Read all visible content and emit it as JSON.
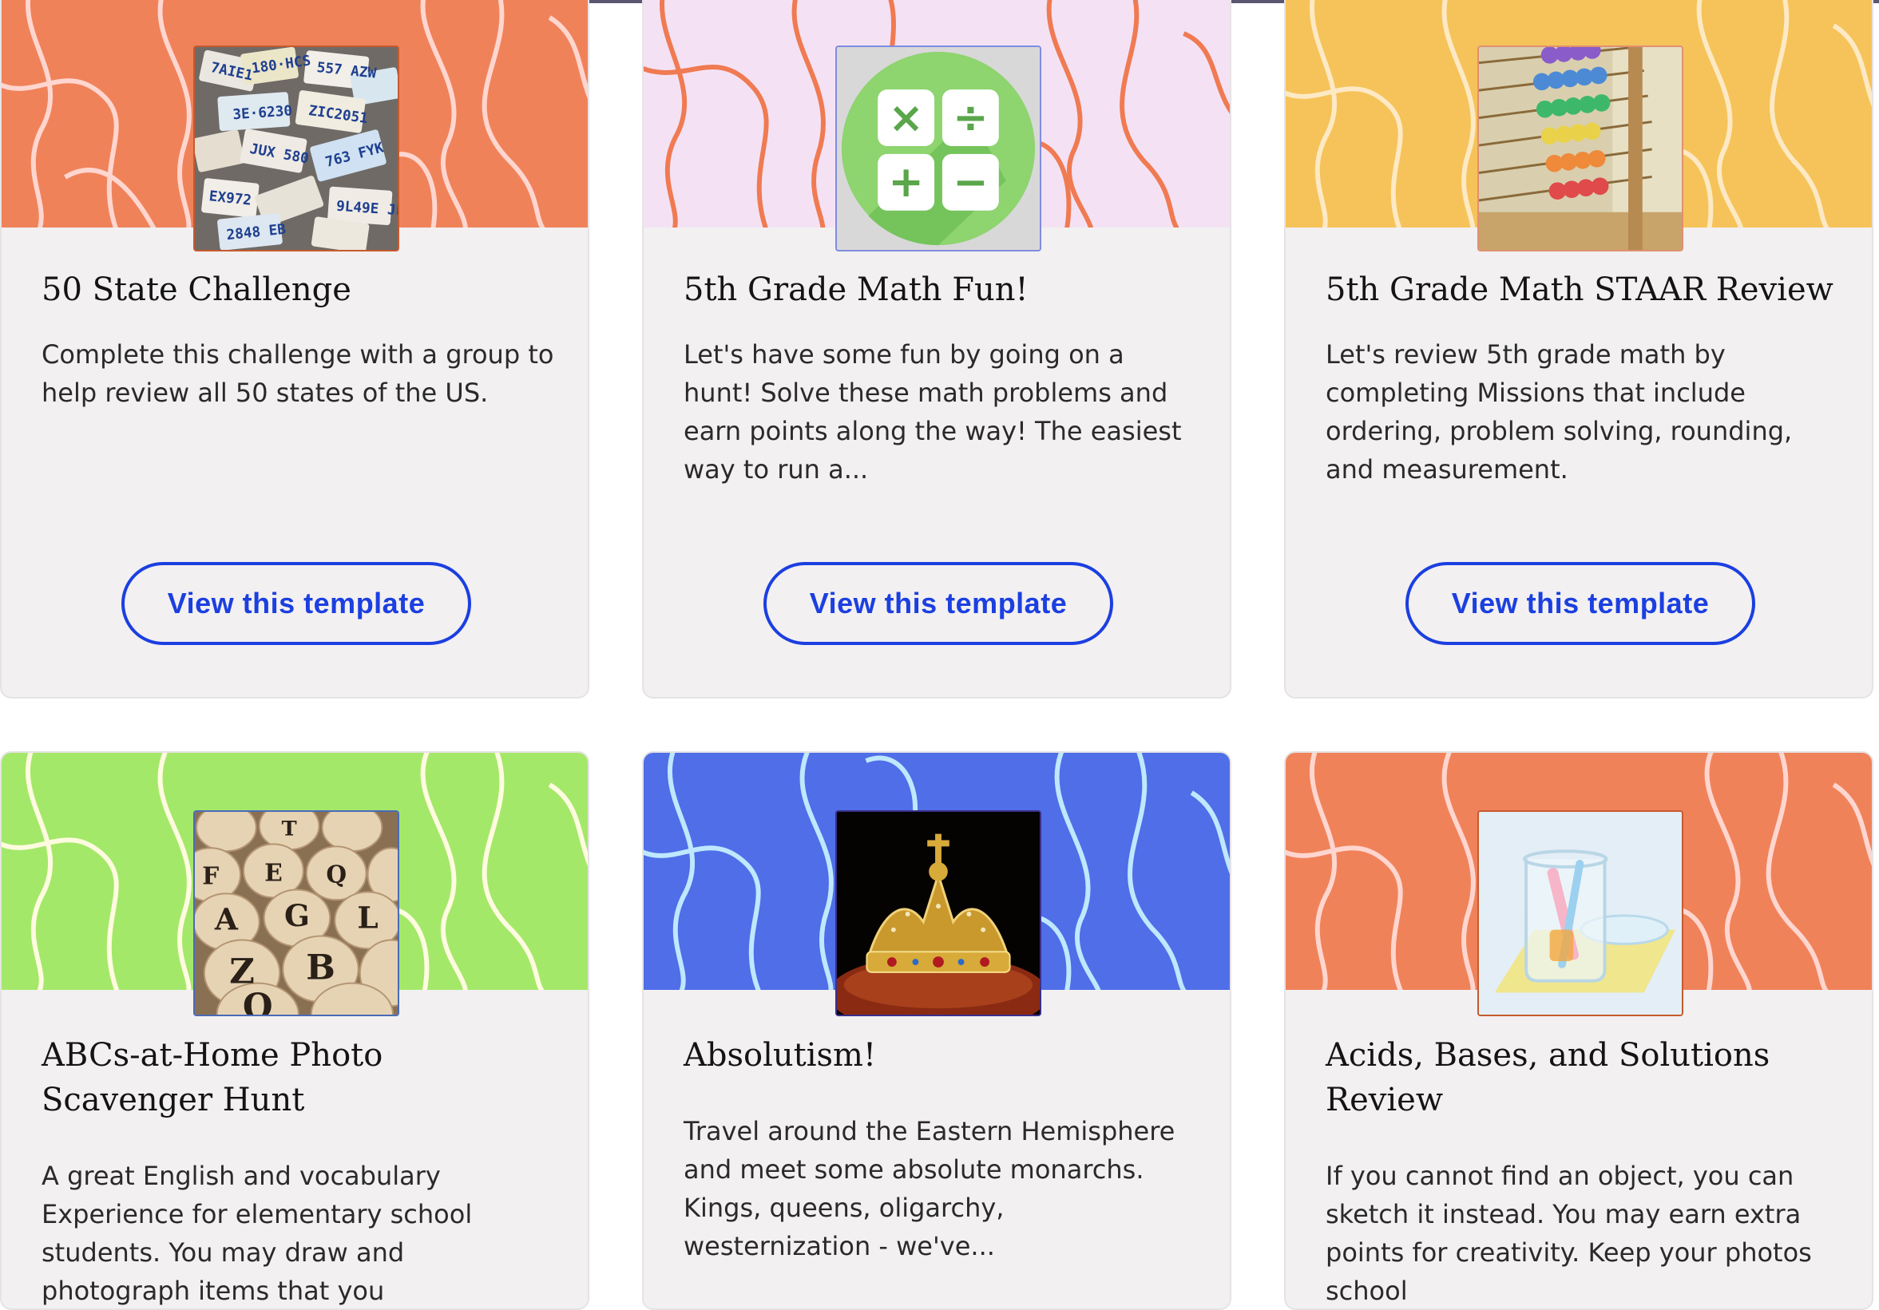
{
  "templates": [
    {
      "title": "50 State Challenge",
      "description": "Complete this challenge with a group to help review all 50 states of the US.",
      "button_label": "View this template",
      "banner_color": "#f0825a",
      "line_color": "#ffd6cf",
      "thumb_icon": "license-plates-photo"
    },
    {
      "title": "5th Grade Math Fun!",
      "description": "Let's have some fun by going on a hunt! Solve these math problems and earn points along the way! The easiest way to run a...",
      "button_label": "View this template",
      "banner_color": "#f4e2f4",
      "line_color": "#f07a52",
      "thumb_icon": "calculator-icon",
      "thumb_symbols": [
        "×",
        "÷",
        "+",
        "−"
      ]
    },
    {
      "title": "5th Grade Math STAAR Review",
      "description": "Let's review 5th grade math by completing Missions that include ordering, problem solving, rounding, and measurement.",
      "button_label": "View this template",
      "banner_color": "#f6c35a",
      "line_color": "#fde9c4",
      "thumb_icon": "abacus-photo"
    },
    {
      "title": "ABCs-at-Home Photo Scavenger Hunt",
      "description": "A great English and vocabulary Experience for elementary school students. You may draw and photograph items that you",
      "banner_color": "#a4e86a",
      "line_color": "#fffbe0",
      "thumb_icon": "letter-blocks-photo",
      "thumb_letters": [
        "A",
        "G",
        "L",
        "Z",
        "B",
        "Q",
        "E",
        "Q",
        "F",
        "T"
      ]
    },
    {
      "title": "Absolutism!",
      "description": "Travel around the Eastern Hemisphere and meet some absolute monarchs. Kings, queens, oligarchy, westernization - we've...",
      "banner_color": "#4f6ee8",
      "line_color": "#bfe8ff",
      "thumb_icon": "crown-photo"
    },
    {
      "title": "Acids, Bases, and Solutions Review",
      "description": "If you cannot find an object, you can sketch it instead. You may earn extra points for creativity. Keep your photos school",
      "banner_color": "#f0825a",
      "line_color": "#ffd6cf",
      "thumb_icon": "beaker-photo"
    }
  ]
}
